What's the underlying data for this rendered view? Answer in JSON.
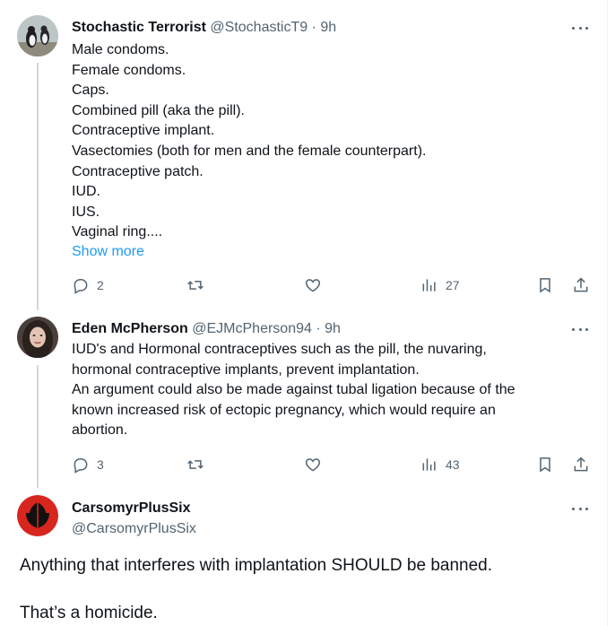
{
  "tweets": [
    {
      "display_name": "Stochastic Terrorist",
      "handle_meta": "@StochasticT9 · 9h",
      "lines": [
        "Male condoms.",
        "Female condoms.",
        "Caps.",
        "Combined pill (aka the pill).",
        "Contraceptive implant.",
        "Vasectomies (both for men and the female counterpart).",
        "Contraceptive patch.",
        "IUD.",
        "IUS.",
        "Vaginal ring...."
      ],
      "show_more": "Show more",
      "reply_count": "2",
      "views_count": "27"
    },
    {
      "display_name": "Eden McPherson",
      "handle_meta": "@EJMcPherson94 · 9h",
      "lines": [
        "IUD's and Hormonal contraceptives such as the pill, the nuvaring,",
        "hormonal contraceptive implants, prevent implantation.",
        "An argument could also be made against tubal ligation because of the",
        "known increased risk of ectopic pregnancy, which would require an",
        "abortion."
      ],
      "reply_count": "3",
      "views_count": "43"
    }
  ],
  "main_tweet": {
    "display_name": "CarsomyrPlusSix",
    "handle": "@CarsomyrPlusSix",
    "text_line1": "Anything that interferes with implantation SHOULD be banned.",
    "text_line2": "That’s a homicide."
  },
  "colors": {
    "text_primary": "#0f1419",
    "text_secondary": "#536471",
    "link": "#1d9bf0",
    "thread_line": "#cfd9de",
    "avatar_red": "#d7261e"
  }
}
